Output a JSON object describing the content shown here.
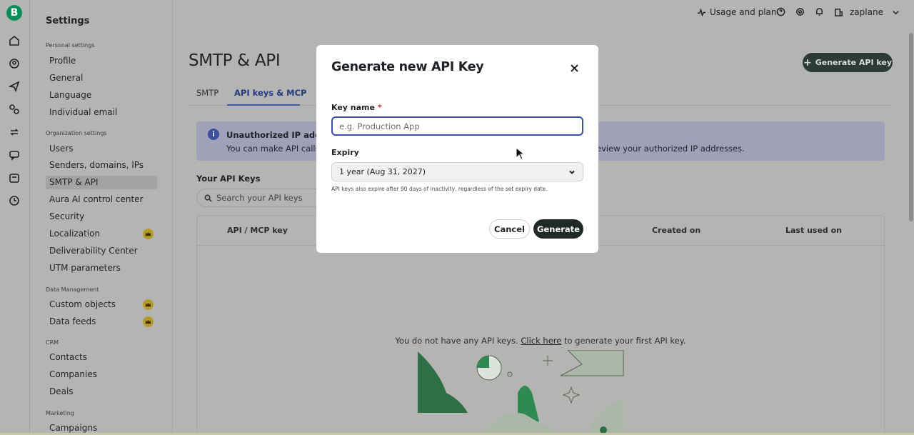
{
  "rail": {
    "logo": "B"
  },
  "sidebar": {
    "title": "Settings",
    "sections": {
      "personal": "Personal settings",
      "organization": "Organization settings",
      "data": "Data Management",
      "crm": "CRM",
      "marketing": "Marketing"
    },
    "items": {
      "profile": "Profile",
      "general": "General",
      "language": "Language",
      "individual_email": "Individual email",
      "users": "Users",
      "senders": "Senders, domains, IPs",
      "smtp_api": "SMTP & API",
      "aura": "Aura AI control center",
      "security": "Security",
      "localization": "Localization",
      "deliverability": "Deliverability Center",
      "utm": "UTM parameters",
      "custom_objects": "Custom objects",
      "data_feeds": "Data feeds",
      "contacts": "Contacts",
      "companies": "Companies",
      "deals": "Deals",
      "campaigns": "Campaigns"
    }
  },
  "topbar": {
    "usage": "Usage and plan",
    "account": "zaplane"
  },
  "page": {
    "title": "SMTP & API",
    "generate_button": "Generate API key",
    "tabs": {
      "smtp": "SMTP",
      "api_keys": "API keys & MCP"
    },
    "banner": {
      "title": "Unauthorized IP address",
      "text_start": "You can make API calls o",
      "text_end": "eview your authorized IP addresses."
    },
    "your_keys": "Your API Keys",
    "search_placeholder": "Search your API keys",
    "table": {
      "col_key": "API / MCP key",
      "col_created": "Created on",
      "col_last_used": "Last used on",
      "empty_prefix": "You do not have any API keys. ",
      "empty_link": "Click here",
      "empty_suffix": " to generate your first API key."
    }
  },
  "modal": {
    "title": "Generate new API Key",
    "key_name_label": "Key name",
    "required_mark": "*",
    "key_name_placeholder": "e.g. Production App",
    "expiry_label": "Expiry",
    "expiry_value": "1 year (Aug 31, 2027)",
    "hint": "API keys also expire after 90 days of inactivity, regardless of the set expiry date.",
    "cancel": "Cancel",
    "generate": "Generate"
  },
  "colors": {
    "accent": "#3d4ea3",
    "brand": "#0b8f5a",
    "primary_button": "#1f2a27"
  }
}
